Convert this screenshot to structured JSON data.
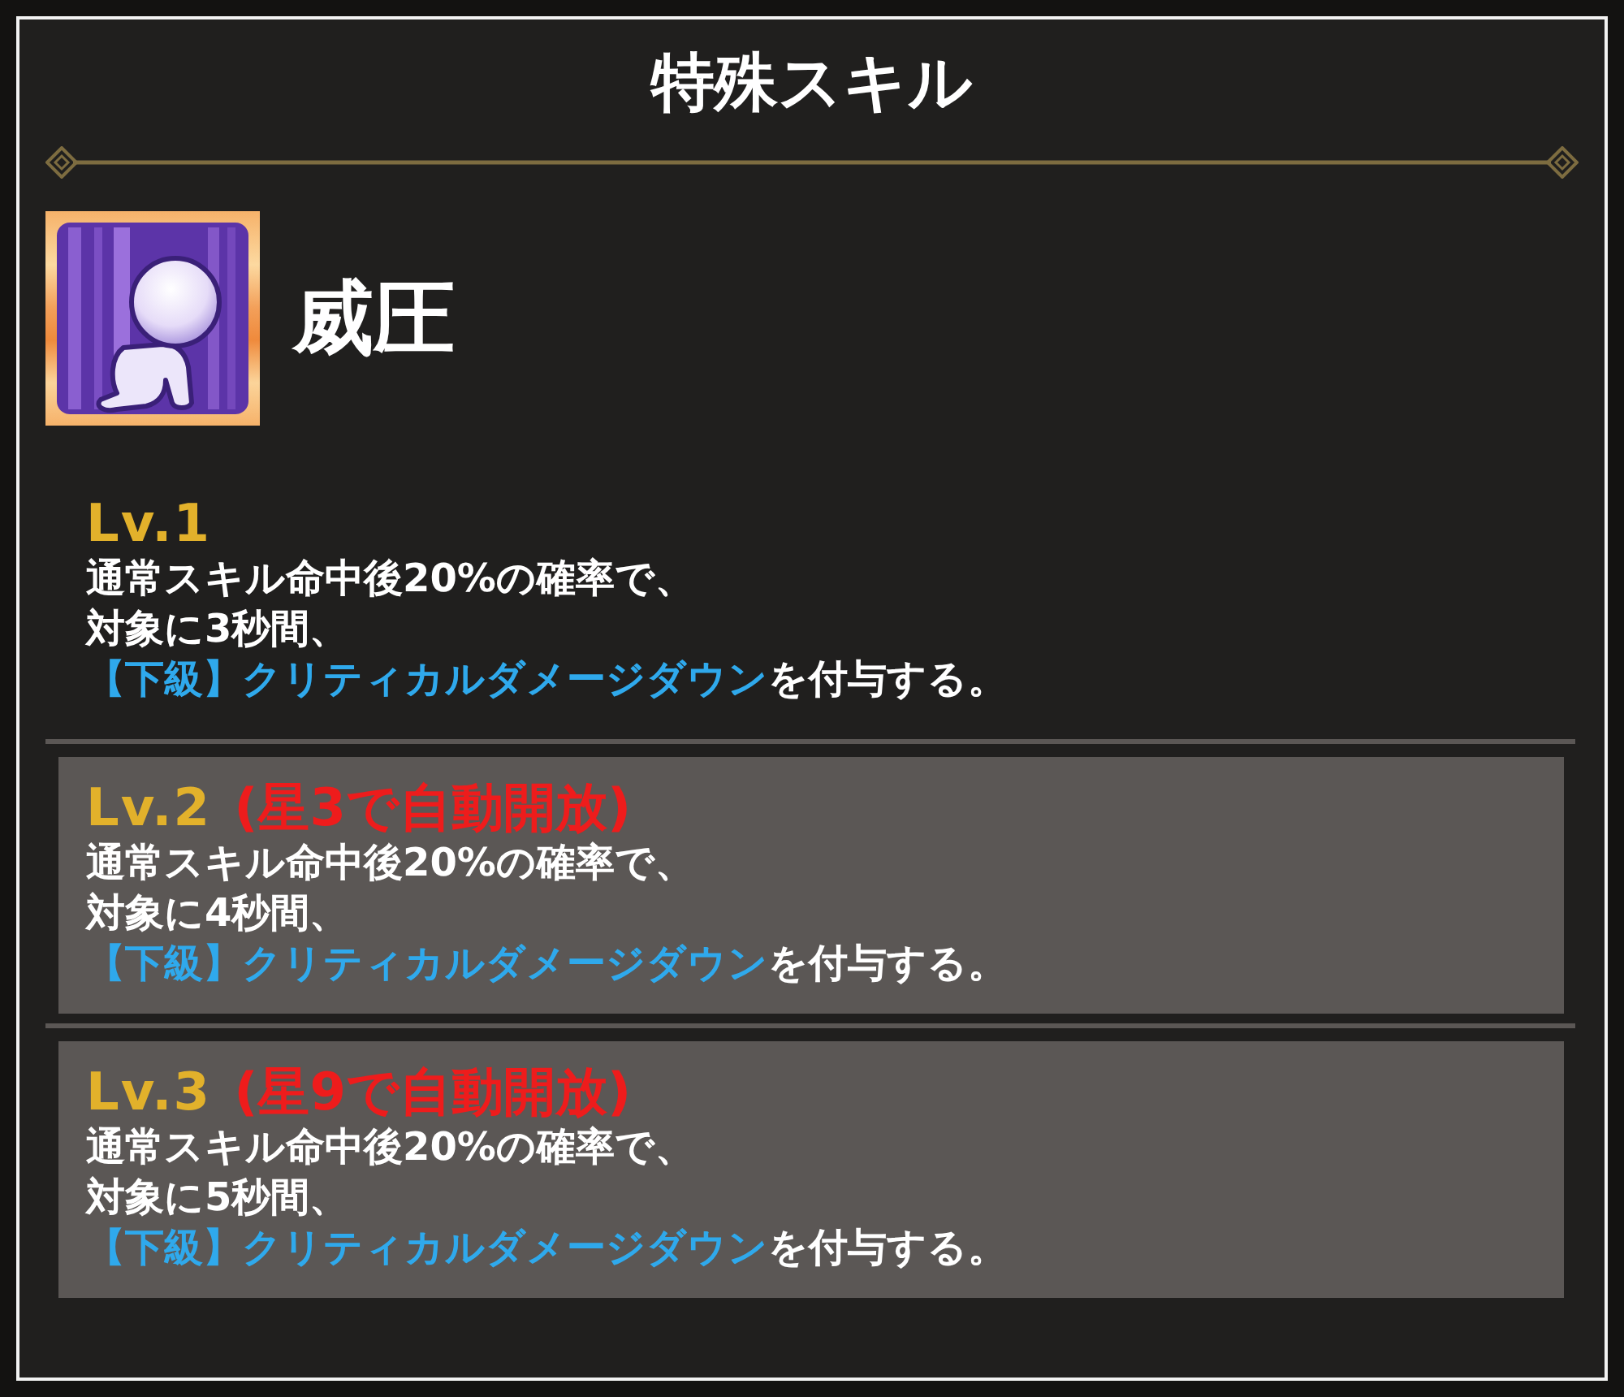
{
  "window": {
    "title": "特殊スキル"
  },
  "skill": {
    "name": "威圧"
  },
  "levels": [
    {
      "label": "Lv.1",
      "locked": false,
      "lines": [
        "通常スキル命中後20%の確率で、",
        "対象に3秒間、"
      ],
      "effect": "【下級】クリティカルダメージダウン",
      "effect_suffix": "を付与する。"
    },
    {
      "label": "Lv.2",
      "locked": true,
      "unlock_condition": "(星3で自動開放)",
      "lines": [
        "通常スキル命中後20%の確率で、",
        "対象に4秒間、"
      ],
      "effect": "【下級】クリティカルダメージダウン",
      "effect_suffix": "を付与する。"
    },
    {
      "label": "Lv.3",
      "locked": true,
      "unlock_condition": "(星9で自動開放)",
      "lines": [
        "通常スキル命中後20%の確率で、",
        "対象に5秒間、"
      ],
      "effect": "【下級】クリティカルダメージダウン",
      "effect_suffix": "を付与する。"
    }
  ]
}
